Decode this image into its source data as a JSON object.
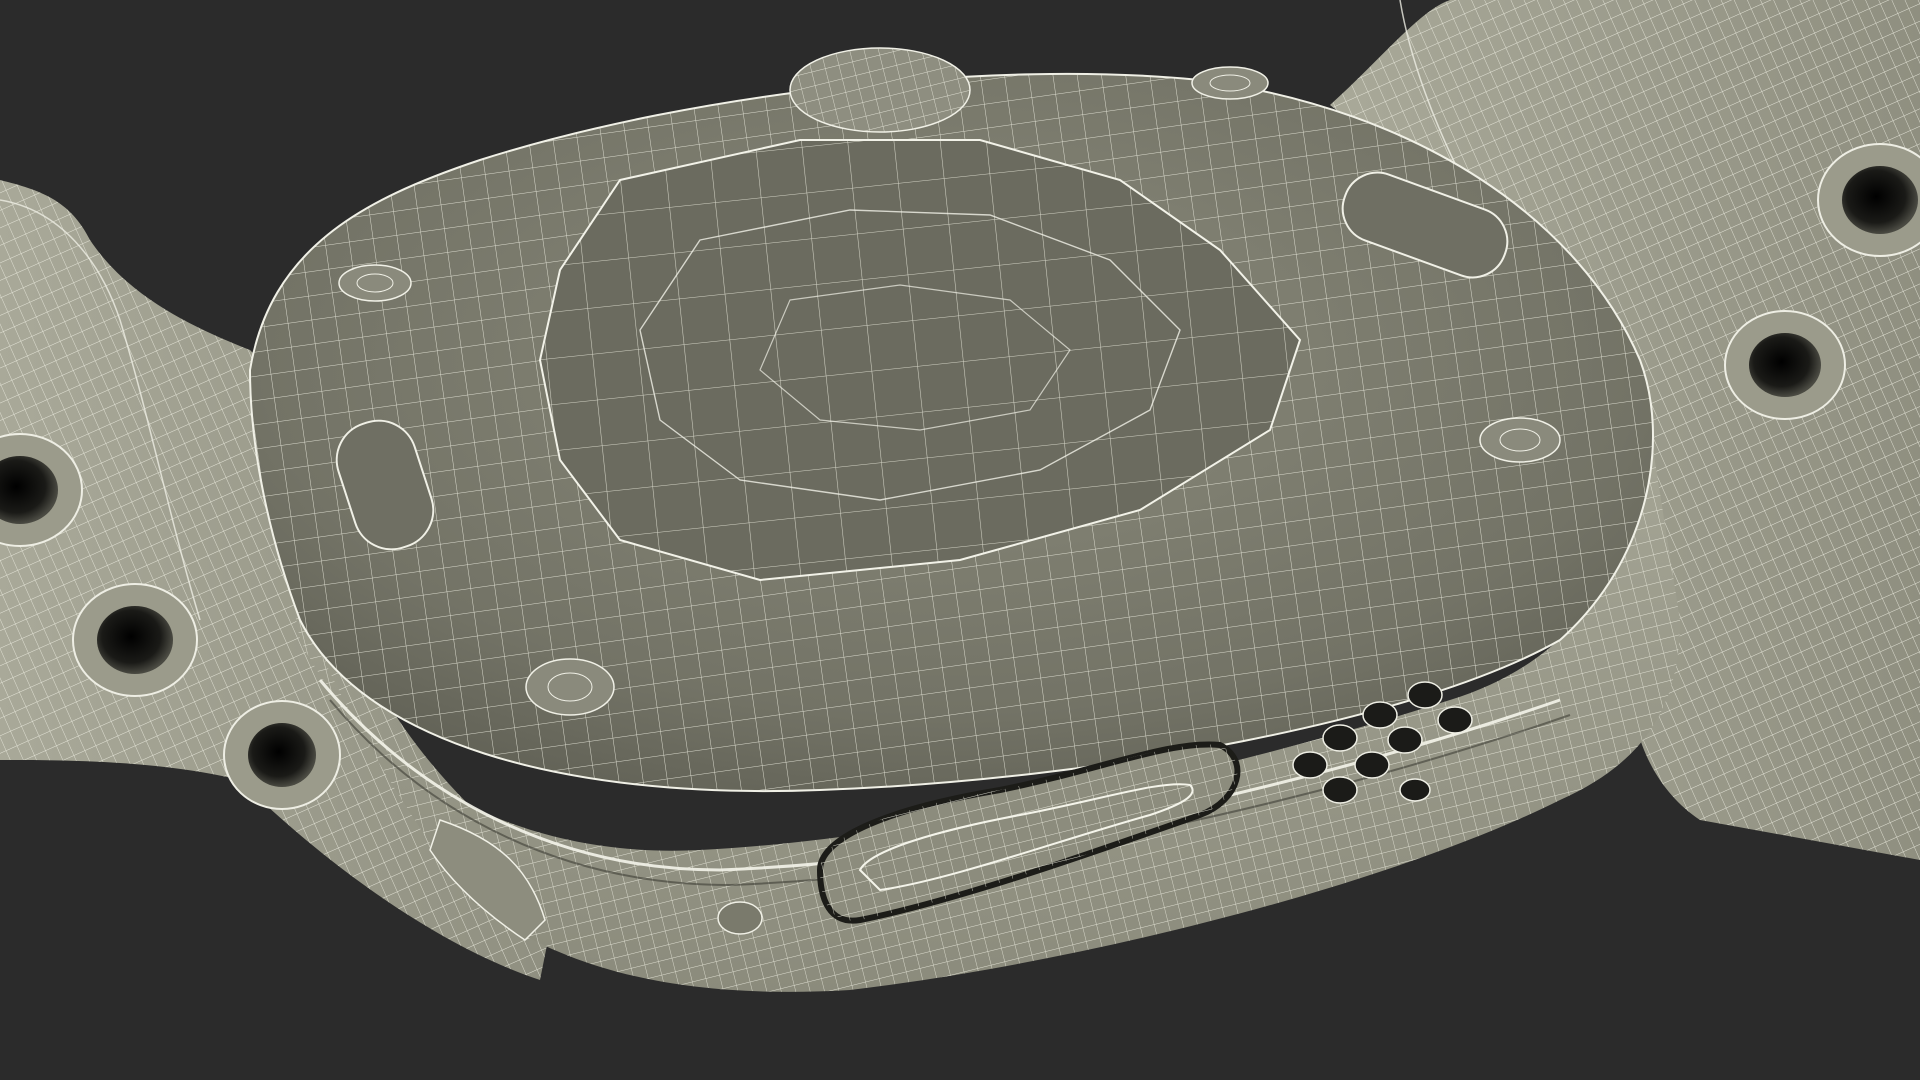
{
  "viewport": {
    "background": "#2b2b2b",
    "subject_icon": "smartwatch-wireframe-icon",
    "colors": {
      "shell_light": "#9c9c8c",
      "shell_mid": "#7a7a6c",
      "shell_dark": "#54544a",
      "wire": "#eeeee4",
      "hole_dark": "#111111"
    }
  }
}
